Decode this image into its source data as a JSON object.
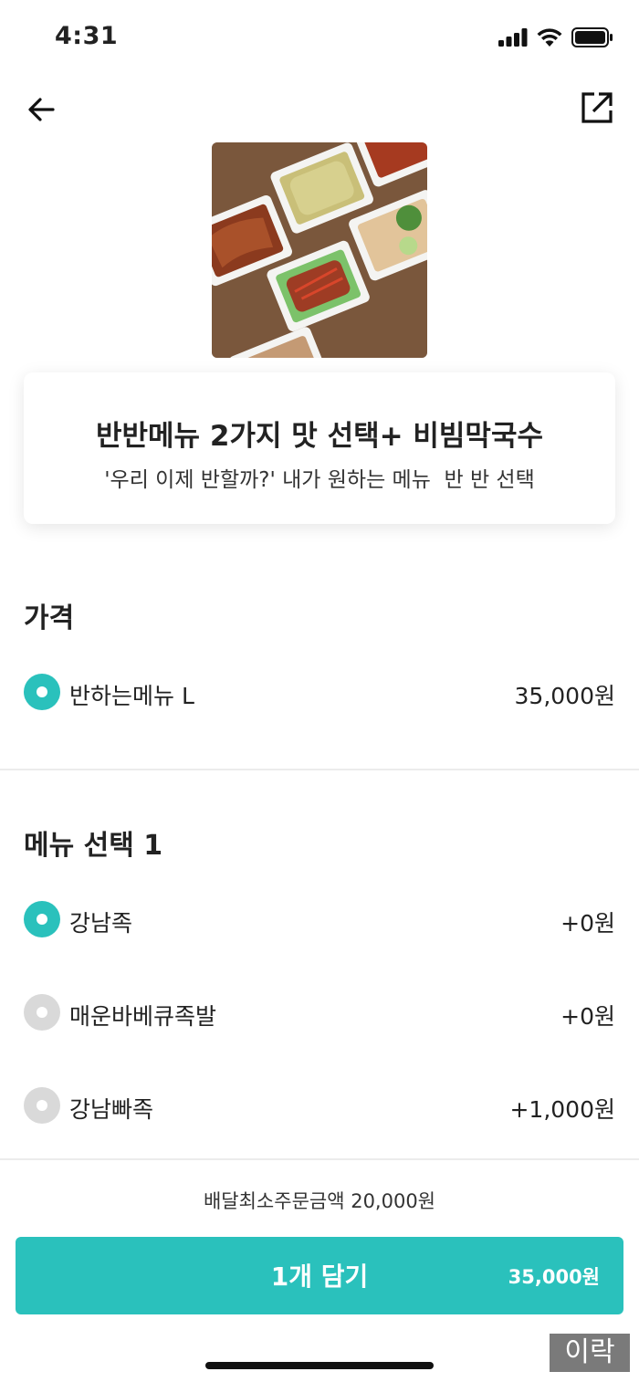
{
  "status_bar": {
    "time": "4:31"
  },
  "product": {
    "title": "반반메뉴 2가지 맛 선택+ 비빔막국수",
    "description": "'우리 이제 반할까?' 내가 원하는 메뉴  반 반 선택"
  },
  "price_section": {
    "title": "가격",
    "options": [
      {
        "label": "반하는메뉴 L",
        "price": "35,000원",
        "selected": true
      }
    ]
  },
  "menu_section_1": {
    "title": "메뉴 선택 1",
    "options": [
      {
        "label": "강남족",
        "price": "+0원",
        "selected": true
      },
      {
        "label": "매운바베큐족발",
        "price": "+0원",
        "selected": false
      },
      {
        "label": "강남빠족",
        "price": "+1,000원",
        "selected": false
      }
    ]
  },
  "footer": {
    "min_order": "배달최소주문금액 20,000원",
    "cart_label": "1개 담기",
    "cart_total": "35,000원"
  },
  "watermark": "이락",
  "icons": {
    "back": "arrow-left-icon",
    "share": "share-external-icon",
    "signal": "cellular-signal-icon",
    "wifi": "wifi-icon",
    "battery": "battery-icon"
  },
  "colors": {
    "accent": "#2ac1bc",
    "radio_off": "#d9d9d9"
  }
}
